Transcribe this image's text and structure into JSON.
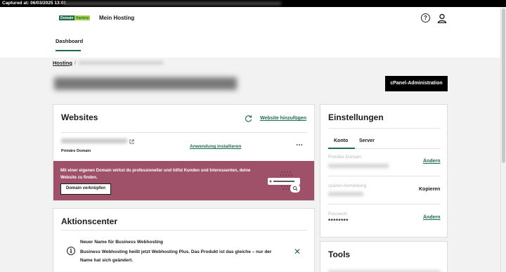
{
  "capture": {
    "label": "Captured at: 06/03/2025 13:01"
  },
  "header": {
    "logo_left": "Domain",
    "logo_right": "Factory",
    "title": "Mein Hosting",
    "nav": {
      "dashboard": "Dashboard"
    }
  },
  "breadcrumb": {
    "hosting": "Hosting",
    "separator": "/"
  },
  "cpanel_button": "cPanel-Administration",
  "websites": {
    "title": "Websites",
    "add_link": "Website hinzufügen",
    "primary_domain_label": "Primäre Domain",
    "install_link": "Anwendung installieren",
    "more_icon": "⋯",
    "promo": {
      "text": "Mit einer eigenen Domain wirkst du professioneller und hilfst Kunden und Interessenten, deine Website zu finden.",
      "button": "Domain verknüpfen"
    }
  },
  "aktionscenter": {
    "title": "Aktionscenter",
    "notice_title": "Neuer Name für Business Webhosting",
    "notice_body": "Business Webhosting heißt jetzt Webhosting Plus. Das Produkt ist das gleiche – nur der Name hat sich geändert."
  },
  "settings": {
    "title": "Einstellungen",
    "tabs": [
      "Konto",
      "Server"
    ],
    "rows": [
      {
        "label": "Primäre Domain",
        "action": "Ändern"
      },
      {
        "label": "cpanel-Anmeldung",
        "action": "Kopieren"
      },
      {
        "label": "Passwort",
        "value": "********",
        "action": "Ändern"
      }
    ]
  },
  "tools": {
    "title": "Tools"
  },
  "colors": {
    "brand_green": "#1e6b4a",
    "promo_bg": "#9e5168",
    "button_dark": "#000000"
  }
}
